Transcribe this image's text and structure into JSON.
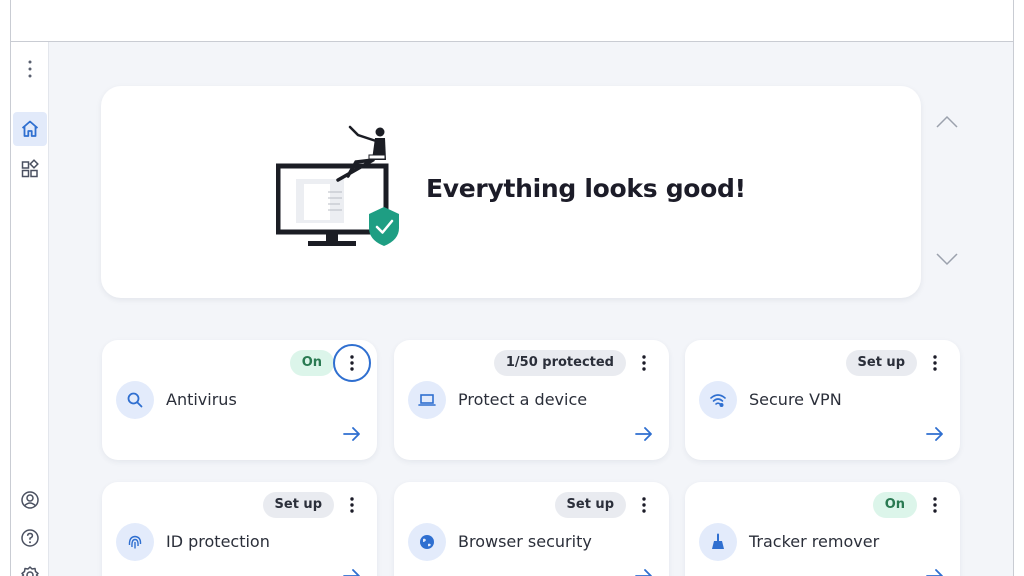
{
  "hero": {
    "title": "Everything looks good!"
  },
  "cards": [
    {
      "label": "Antivirus",
      "badge": "On",
      "icon": "search-icon"
    },
    {
      "label": "Protect a device",
      "badge": "1/50 protected",
      "icon": "laptop-icon"
    },
    {
      "label": "Secure VPN",
      "badge": "Set up",
      "icon": "wifi-icon"
    },
    {
      "label": "ID protection",
      "badge": "Set up",
      "icon": "fingerprint-icon"
    },
    {
      "label": "Browser security",
      "badge": "Set up",
      "icon": "globe-icon"
    },
    {
      "label": "Tracker remover",
      "badge": "On",
      "icon": "broom-icon"
    }
  ],
  "colors": {
    "accent": "#2f6fd0",
    "on_badge_bg": "#dcf5ea",
    "shield": "#1e9e83"
  }
}
